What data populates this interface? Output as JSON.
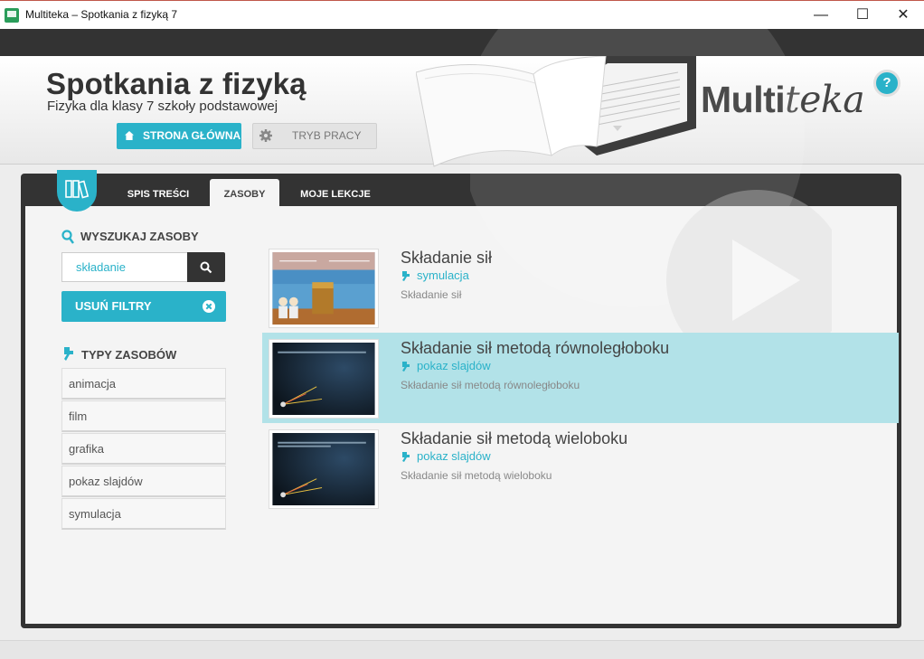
{
  "window": {
    "title": "Multiteka – Spotkania z fizyką 7",
    "minimize": "—",
    "maximize": "☐",
    "close": "✕"
  },
  "header": {
    "title": "Spotkania z fizyką",
    "subtitle": "Fizyka dla klasy 7 szkoły podstawowej",
    "home_label": "STRONA GŁÓWNA",
    "mode_label": "TRYB PRACY",
    "brand_a": "Multi",
    "brand_b": "teka",
    "help": "?"
  },
  "tabs": [
    {
      "label": "SPIS TREŚCI",
      "active": false
    },
    {
      "label": "ZASOBY",
      "active": true
    },
    {
      "label": "MOJE LEKCJE",
      "active": false
    }
  ],
  "search": {
    "title": "WYSZUKAJ ZASOBY",
    "value": "składanie",
    "clear_label": "USUŃ FILTRY"
  },
  "types": {
    "title": "TYPY ZASOBÓW",
    "items": [
      "animacja",
      "film",
      "grafika",
      "pokaz slajdów",
      "symulacja"
    ]
  },
  "results": [
    {
      "title": "Składanie sił",
      "type": "symulacja",
      "description": "Składanie sił",
      "selected": false
    },
    {
      "title": "Składanie sił metodą równoległoboku",
      "type": "pokaz slajdów",
      "description": "Składanie sił metodą równoległoboku",
      "selected": true
    },
    {
      "title": "Składanie sił metodą wieloboku",
      "type": "pokaz slajdów",
      "description": "Składanie sił metodą wieloboku",
      "selected": false
    }
  ],
  "colors": {
    "accent": "#2ab2c9",
    "selected_row": "#b2e2e8",
    "dark": "#333333"
  }
}
